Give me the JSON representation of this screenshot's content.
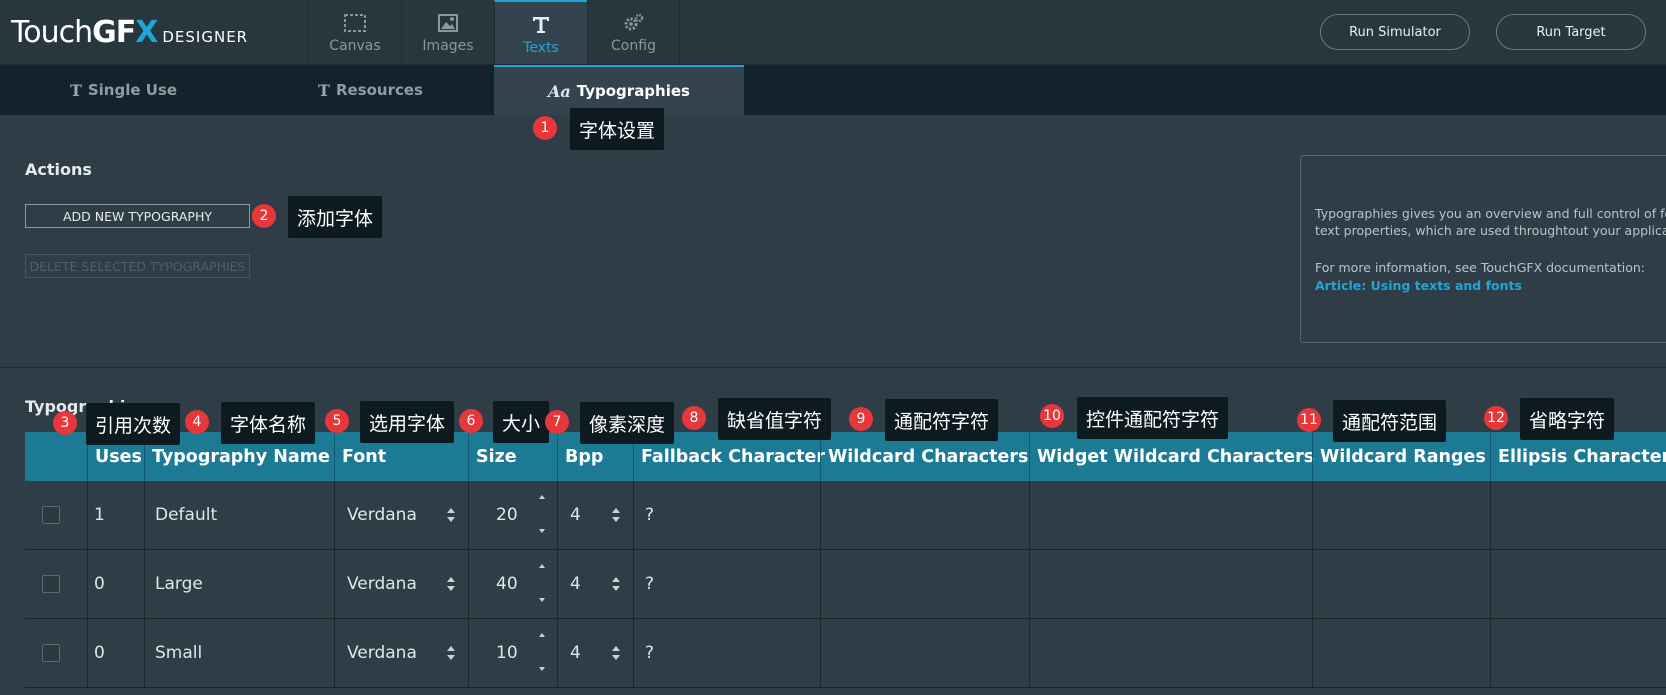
{
  "app": {
    "logo_touch": "Touch",
    "logo_gf": "GF",
    "logo_x": "X",
    "logo_designer": "DESIGNER"
  },
  "nav": {
    "tabs": [
      {
        "label": "Canvas",
        "icon": "canvas-icon"
      },
      {
        "label": "Images",
        "icon": "image-icon"
      },
      {
        "label": "Texts",
        "icon": "text-icon",
        "active": true
      },
      {
        "label": "Config",
        "icon": "gears-icon"
      }
    ],
    "run_simulator": "Run Simulator",
    "run_target": "Run Target"
  },
  "subtabs": [
    {
      "label": "Single Use",
      "icon": "T"
    },
    {
      "label": "Resources",
      "icon": "T"
    },
    {
      "label": "Typographies",
      "icon": "Aa",
      "active": true
    }
  ],
  "actions": {
    "title": "Actions",
    "add_button": "ADD NEW TYPOGRAPHY",
    "delete_button": "DELETE SELECTED TYPOGRAPHIES"
  },
  "info": {
    "line1": "Typographies gives you an overview and full control of for",
    "line2": "text properties, which are used throughtout your applicatio",
    "line3": "For more information, see TouchGFX documentation:",
    "link": "Article: Using texts and fonts"
  },
  "table": {
    "section_title": "Typographies",
    "headers": [
      "Uses",
      "Typography Name",
      "Font",
      "Size",
      "Bpp",
      "Fallback Character",
      "Wildcard Characters",
      "Widget Wildcard Characters",
      "Wildcard Ranges",
      "Ellipsis Character"
    ],
    "rows": [
      {
        "uses": "1",
        "name": "Default",
        "font": "Verdana",
        "size": "20",
        "bpp": "4",
        "fallback": "?"
      },
      {
        "uses": "0",
        "name": "Large",
        "font": "Verdana",
        "size": "40",
        "bpp": "4",
        "fallback": "?"
      },
      {
        "uses": "0",
        "name": "Small",
        "font": "Verdana",
        "size": "10",
        "bpp": "4",
        "fallback": "?"
      }
    ]
  },
  "annotations": [
    {
      "num": "1",
      "text": "字体设置"
    },
    {
      "num": "2",
      "text": "添加字体"
    },
    {
      "num": "3",
      "text": "引用次数"
    },
    {
      "num": "4",
      "text": "字体名称"
    },
    {
      "num": "5",
      "text": "选用字体"
    },
    {
      "num": "6",
      "text": "大小"
    },
    {
      "num": "7",
      "text": "像素深度"
    },
    {
      "num": "8",
      "text": "缺省值字符"
    },
    {
      "num": "9",
      "text": "通配符字符"
    },
    {
      "num": "10",
      "text": "控件通配符字符"
    },
    {
      "num": "11",
      "text": "通配符范围"
    },
    {
      "num": "12",
      "text": "省略字符"
    }
  ],
  "colors": {
    "accent": "#21a5d8",
    "header_bg": "#1d7a95",
    "badge": "#e8373b"
  }
}
